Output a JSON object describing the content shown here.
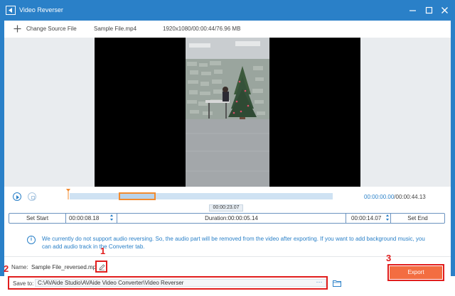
{
  "window": {
    "title": "Video Reverser"
  },
  "toolbar": {
    "change_source_label": "Change Source File",
    "file_name": "Sample File.mp4",
    "file_info": "1920x1080/00:00:44/76.96 MB"
  },
  "timeline": {
    "current_time": "00:00:00.00",
    "total_time": "/00:00:44.13",
    "playhead_time": "00:00:23.07"
  },
  "range": {
    "set_start_label": "Set Start",
    "start_value": "00:00:08.18",
    "duration_text": "Duration:00:00:05.14",
    "end_value": "00:00:14.07",
    "set_end_label": "Set End"
  },
  "notice": {
    "icon": "info-icon",
    "text": "We currently do not support audio reversing. So, the audio part will be removed from the video after exporting. If you want to add background music, you can add audio track in the Converter tab."
  },
  "output": {
    "name_label": "Name:",
    "name_value": "Sample File_reversed.mp4",
    "save_label": "Save to:",
    "save_path": "C:\\AVAide Studio\\AVAide Video Converter\\Video Reverser",
    "more_label": "···",
    "export_label": "Export"
  },
  "callouts": {
    "one": "1",
    "two": "2",
    "three": "3"
  },
  "colors": {
    "accent": "#2a80c8",
    "export": "#f36d41",
    "highlight": "#e11d1d",
    "selection": "#f28b30"
  }
}
